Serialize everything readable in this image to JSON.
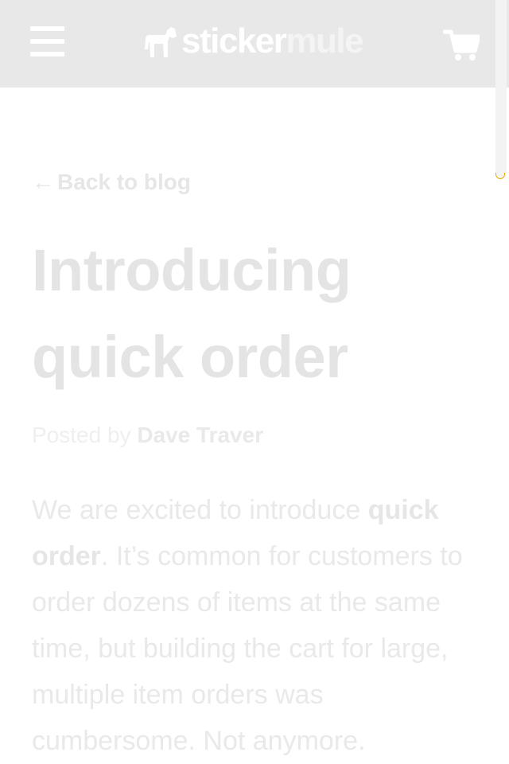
{
  "header": {
    "logo_text_a": "sticker",
    "logo_text_b": "mule",
    "menu_icon": "hamburger-menu-icon",
    "cart_icon": "shopping-cart-icon",
    "background": "#e8e8e8"
  },
  "article": {
    "back_arrow": "←",
    "back_label": "Back to blog",
    "title": "Introducing quick order",
    "byline_prefix": "Posted by",
    "author": "Dave Traver",
    "intro_1": "We are excited to introduce",
    "intro_bold": "quick order",
    "intro_2": ". It’s common for customers to order dozens of items at the same time, but building the cart for large, multiple item orders was cumbersome. Not anymore."
  }
}
